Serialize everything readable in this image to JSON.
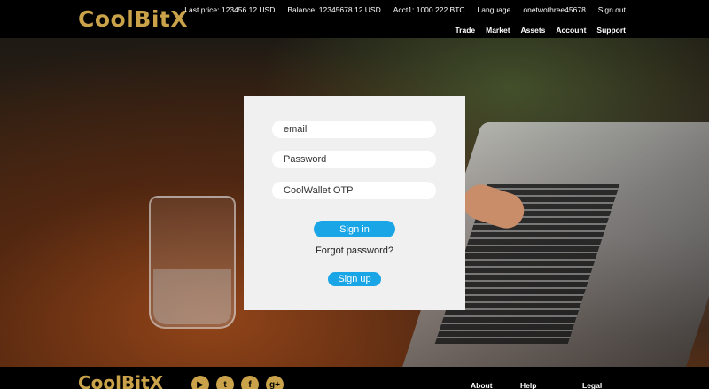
{
  "header": {
    "logo": "CoolBitX",
    "last_price": "Last price: 123456.12 USD",
    "balance": "Balance: 12345678.12 USD",
    "account": "Acct1: 1000.222 BTC",
    "language": "Language",
    "username": "onetwothree45678",
    "sign_out": "Sign out",
    "nav": [
      "Trade",
      "Market",
      "Assets",
      "Account",
      "Support"
    ]
  },
  "login": {
    "email_placeholder": "email",
    "password_placeholder": "Password",
    "otp_placeholder": "CoolWallet OTP",
    "sign_in": "Sign in",
    "forgot": "Forgot password?",
    "sign_up": "Sign up"
  },
  "footer": {
    "logo": "CoolBitX",
    "social_icons": [
      "youtube-icon",
      "twitter-icon",
      "facebook-icon",
      "google-plus-icon"
    ],
    "links": [
      "About",
      "Help",
      "Legal"
    ]
  },
  "colors": {
    "brand_gold": "#c9a24a",
    "button_blue": "#1aa6e6",
    "panel_bg": "#f0f0f0"
  }
}
